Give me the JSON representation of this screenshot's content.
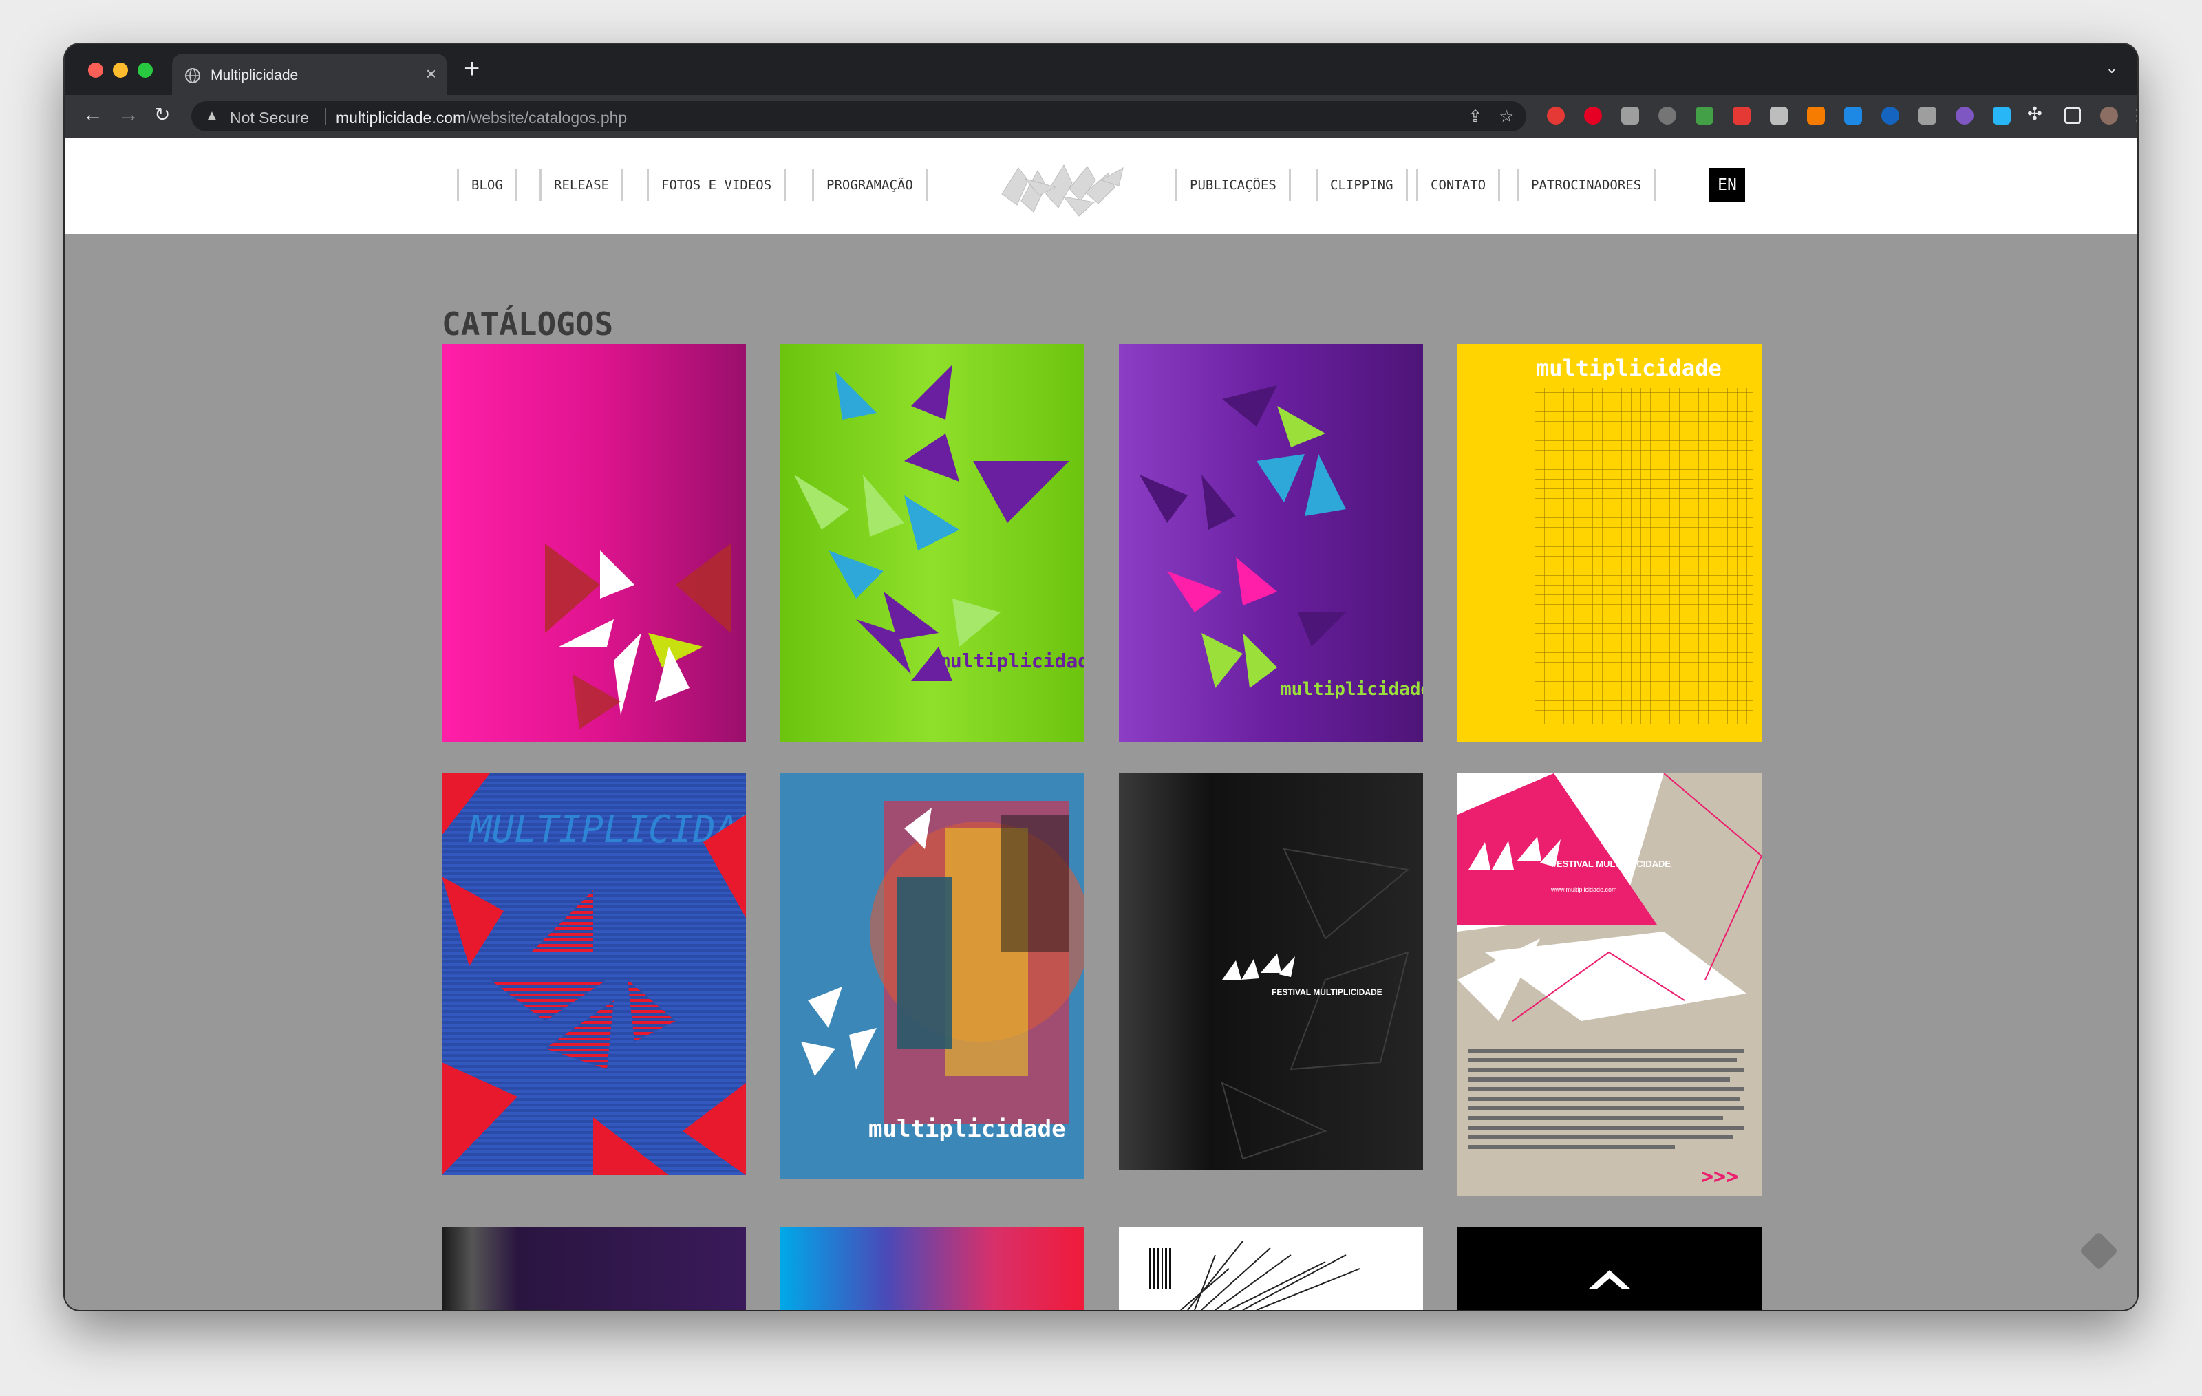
{
  "browser": {
    "tab_title": "Multiplicidade",
    "tab_close": "×",
    "new_tab": "+",
    "security_label": "Not Secure",
    "url_host": "multiplicidade.com",
    "url_path": "/website/catalogos.php"
  },
  "nav": {
    "left": [
      "BLOG",
      "RELEASE",
      "FOTOS E VIDEOS",
      "PROGRAMAÇÃO"
    ],
    "right": [
      "PUBLICAÇÕES",
      "CLIPPING",
      "CONTATO",
      "PATROCINADORES"
    ],
    "lang": "EN"
  },
  "page": {
    "title": "CATÁLOGOS"
  },
  "catalogs": [
    {
      "cover_text": "",
      "color": "#e0148f"
    },
    {
      "cover_text": "multiplicidade",
      "color": "#7fd01a"
    },
    {
      "cover_text": "multiplicidade",
      "color": "#6a1fa0"
    },
    {
      "cover_text": "multiplicidade",
      "color": "#ffd400"
    },
    {
      "cover_text": "MULTIPLICIDADE",
      "color": "#2b4ba8"
    },
    {
      "cover_text": "multiplicidade",
      "color": "#3a87b8"
    },
    {
      "cover_text": "FESTIVAL MULTIPLICIDADE",
      "color": "#1a1a1a"
    },
    {
      "cover_text": "FESTIVAL MULTIPLICIDADE",
      "color": "#c9c0b0",
      "cover_subtext": "www.multiplicidade.com",
      "cover_arrows": ">>>"
    },
    {
      "cover_text": "",
      "color": "#2a1540"
    },
    {
      "cover_text": "",
      "color": "#1a9fe0"
    },
    {
      "cover_text": "",
      "color": "#ffffff"
    },
    {
      "cover_text": "",
      "color": "#000000"
    }
  ]
}
